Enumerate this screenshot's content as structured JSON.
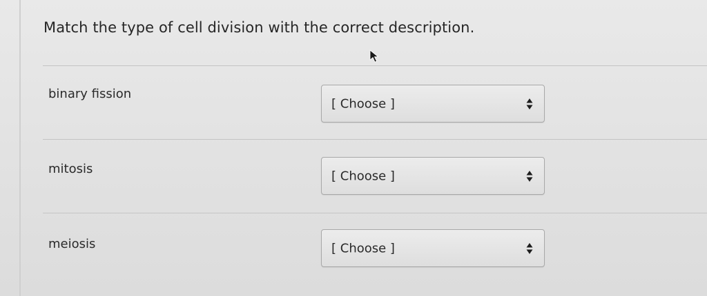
{
  "question": {
    "title": "Match the type of cell division with the correct description."
  },
  "rows": [
    {
      "term": "binary fission",
      "selected": "[ Choose ]"
    },
    {
      "term": "mitosis",
      "selected": "[ Choose ]"
    },
    {
      "term": "meiosis",
      "selected": "[ Choose ]"
    }
  ],
  "icons": {
    "cursor": "mouse-cursor-icon",
    "select_arrows": "up-down-arrows-icon"
  },
  "colors": {
    "background": "#e3e3e3",
    "text": "#2a2a2a",
    "select_border": "#a8a8a8"
  }
}
